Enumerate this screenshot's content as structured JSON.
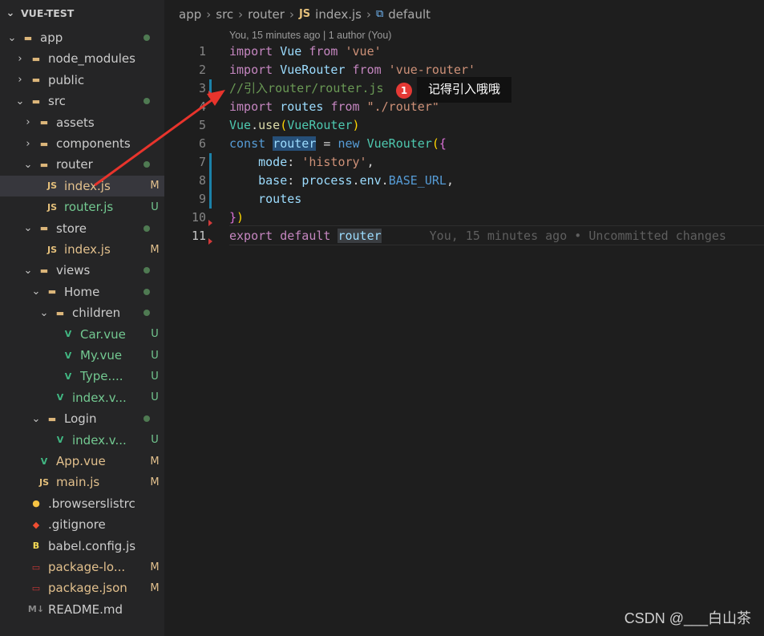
{
  "explorer": {
    "title": "VUE-TEST",
    "items": [
      {
        "label": "app",
        "chev": "⌄",
        "icon": "folder-icon",
        "indent": 1,
        "status": "dot"
      },
      {
        "label": "node_modules",
        "chev": "›",
        "icon": "folder-icon",
        "indent": 2,
        "status": ""
      },
      {
        "label": "public",
        "chev": "›",
        "icon": "folder-icon",
        "indent": 2,
        "status": ""
      },
      {
        "label": "src",
        "chev": "⌄",
        "icon": "folder-icon",
        "indent": 2,
        "status": "dot"
      },
      {
        "label": "assets",
        "chev": "›",
        "icon": "folder-icon",
        "indent": 3,
        "status": ""
      },
      {
        "label": "components",
        "chev": "›",
        "icon": "folder-icon",
        "indent": 3,
        "status": ""
      },
      {
        "label": "router",
        "chev": "⌄",
        "icon": "folder-icon",
        "indent": 3,
        "status": "dot"
      },
      {
        "label": "index.js",
        "chev": "",
        "icon": "js-file-icon",
        "indent": 4,
        "status": "M"
      },
      {
        "label": "router.js",
        "chev": "",
        "icon": "js-file-icon",
        "indent": 4,
        "status": "U"
      },
      {
        "label": "store",
        "chev": "⌄",
        "icon": "folder-icon",
        "indent": 3,
        "status": "dot"
      },
      {
        "label": "index.js",
        "chev": "",
        "icon": "js-file-icon",
        "indent": 4,
        "status": "M"
      },
      {
        "label": "views",
        "chev": "⌄",
        "icon": "folder-icon",
        "indent": 3,
        "status": "dot"
      },
      {
        "label": "Home",
        "chev": "⌄",
        "icon": "folder-icon",
        "indent": 4,
        "status": "dot"
      },
      {
        "label": "children",
        "chev": "⌄",
        "icon": "folder-icon",
        "indent": 5,
        "status": "dot"
      },
      {
        "label": "Car.vue",
        "chev": "",
        "icon": "vue-file-icon",
        "indent": 6,
        "status": "U"
      },
      {
        "label": "My.vue",
        "chev": "",
        "icon": "vue-file-icon",
        "indent": 6,
        "status": "U"
      },
      {
        "label": "Type....",
        "chev": "",
        "icon": "vue-file-icon",
        "indent": 6,
        "status": "U"
      },
      {
        "label": "index.v...",
        "chev": "",
        "icon": "vue-file-icon",
        "indent": 5,
        "status": "U"
      },
      {
        "label": "Login",
        "chev": "⌄",
        "icon": "folder-icon",
        "indent": 4,
        "status": "dot"
      },
      {
        "label": "index.v...",
        "chev": "",
        "icon": "vue-file-icon",
        "indent": 5,
        "status": "U"
      },
      {
        "label": "App.vue",
        "chev": "",
        "icon": "vue-file-icon",
        "indent": 3,
        "status": "M"
      },
      {
        "label": "main.js",
        "chev": "",
        "icon": "js-file-icon",
        "indent": 3,
        "status": "M"
      },
      {
        "label": ".browserslistrc",
        "chev": "",
        "icon": "browserslist-icon",
        "indent": 2,
        "status": ""
      },
      {
        "label": ".gitignore",
        "chev": "",
        "icon": "git-icon",
        "indent": 2,
        "status": ""
      },
      {
        "label": "babel.config.js",
        "chev": "",
        "icon": "babel-icon",
        "indent": 2,
        "status": ""
      },
      {
        "label": "package-lo...",
        "chev": "",
        "icon": "npm-icon",
        "indent": 2,
        "status": "M"
      },
      {
        "label": "package.json",
        "chev": "",
        "icon": "npm-icon",
        "indent": 2,
        "status": "M"
      },
      {
        "label": "README.md",
        "chev": "",
        "icon": "markdown-icon",
        "indent": 2,
        "status": ""
      }
    ]
  },
  "breadcrumb": {
    "p1": "app",
    "p2": "src",
    "p3": "router",
    "js": "JS",
    "file": "index.js",
    "sym": "default",
    "sep": "›"
  },
  "codelens": "You, 15 minutes ago | 1 author (You)",
  "line_numbers": [
    "1",
    "2",
    "3",
    "4",
    "5",
    "6",
    "7",
    "8",
    "9",
    "10",
    "11"
  ],
  "code": {
    "l1": [
      "import",
      " Vue ",
      "from",
      " 'vue'"
    ],
    "l2": [
      "import",
      " VueRouter ",
      "from",
      " 'vue-router'"
    ],
    "l3": "//引入router/router.js",
    "l4": [
      "import",
      " routes ",
      "from",
      " \"./router\""
    ],
    "l5": [
      "Vue",
      ".",
      "use",
      "(",
      "VueRouter",
      ")"
    ],
    "l6": [
      "const",
      " ",
      "router",
      " = ",
      "new",
      " ",
      "VueRouter",
      "(",
      "{"
    ],
    "l7": [
      "    mode",
      ": ",
      "'history'",
      ","
    ],
    "l8": [
      "    base",
      ": ",
      "process",
      ".",
      "env",
      ".",
      "BASE_URL",
      ","
    ],
    "l9": "    routes",
    "l10": [
      "}",
      ")"
    ],
    "l11": [
      "export",
      " ",
      "default",
      " ",
      "router"
    ],
    "blame": "You, 15 minutes ago • Uncommitted changes"
  },
  "annotation": {
    "number": "1",
    "text": "记得引入哦哦"
  },
  "watermark": "CSDN @___白山茶",
  "colors": {
    "accent": "#e53935",
    "modified": "#e2c08d",
    "untracked": "#73c991"
  }
}
